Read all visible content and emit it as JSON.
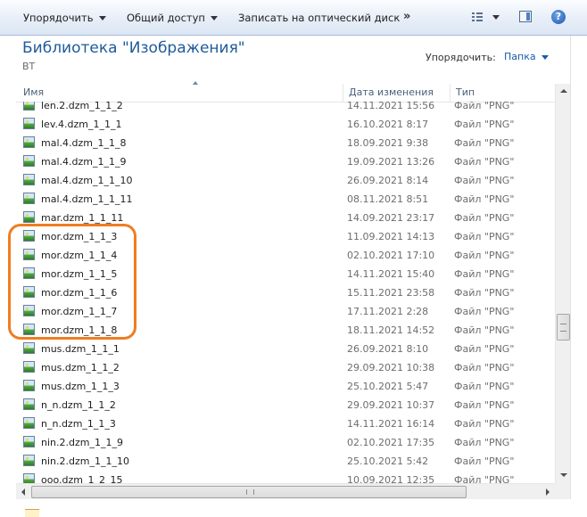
{
  "toolbar": {
    "organize": "Упорядочить",
    "share": "Общий доступ",
    "burn": "Записать на оптический диск",
    "more": "»",
    "help": "?"
  },
  "library": {
    "title": "Библиотека \"Изображения\"",
    "subtitle": "ВТ",
    "arrange_label": "Упорядочить:",
    "arrange_value": "Папка"
  },
  "columns": {
    "name": "Имя",
    "date": "Дата изменения",
    "type": "Тип"
  },
  "files": [
    {
      "name": "len.2.dzm_1_1_2",
      "date": "14.11.2021 15:56",
      "type": "Файл \"PNG\""
    },
    {
      "name": "lev.4.dzm_1_1_1",
      "date": "16.10.2021 8:17",
      "type": "Файл \"PNG\""
    },
    {
      "name": "mal.4.dzm_1_1_8",
      "date": "18.09.2021 9:38",
      "type": "Файл \"PNG\""
    },
    {
      "name": "mal.4.dzm_1_1_9",
      "date": "19.09.2021 13:26",
      "type": "Файл \"PNG\""
    },
    {
      "name": "mal.4.dzm_1_1_10",
      "date": "26.09.2021 8:14",
      "type": "Файл \"PNG\""
    },
    {
      "name": "mal.4.dzm_1_1_11",
      "date": "08.11.2021 8:51",
      "type": "Файл \"PNG\""
    },
    {
      "name": "mar.dzm_1_1_11",
      "date": "14.09.2021 23:17",
      "type": "Файл \"PNG\""
    },
    {
      "name": "mor.dzm_1_1_3",
      "date": "11.09.2021 14:13",
      "type": "Файл \"PNG\""
    },
    {
      "name": "mor.dzm_1_1_4",
      "date": "02.10.2021 17:10",
      "type": "Файл \"PNG\""
    },
    {
      "name": "mor.dzm_1_1_5",
      "date": "14.11.2021 15:40",
      "type": "Файл \"PNG\""
    },
    {
      "name": "mor.dzm_1_1_6",
      "date": "15.11.2021 23:58",
      "type": "Файл \"PNG\""
    },
    {
      "name": "mor.dzm_1_1_7",
      "date": "17.11.2021 2:28",
      "type": "Файл \"PNG\""
    },
    {
      "name": "mor.dzm_1_1_8",
      "date": "18.11.2021 14:52",
      "type": "Файл \"PNG\""
    },
    {
      "name": "mus.dzm_1_1_1",
      "date": "26.09.2021 8:10",
      "type": "Файл \"PNG\""
    },
    {
      "name": "mus.dzm_1_1_2",
      "date": "29.09.2021 10:38",
      "type": "Файл \"PNG\""
    },
    {
      "name": "mus.dzm_1_1_3",
      "date": "25.10.2021 5:47",
      "type": "Файл \"PNG\""
    },
    {
      "name": "n_n.dzm_1_1_2",
      "date": "29.09.2021 10:37",
      "type": "Файл \"PNG\""
    },
    {
      "name": "n_n.dzm_1_1_3",
      "date": "14.11.2021 16:14",
      "type": "Файл \"PNG\""
    },
    {
      "name": "nin.2.dzm_1_1_9",
      "date": "02.10.2021 17:35",
      "type": "Файл \"PNG\""
    },
    {
      "name": "nin.2.dzm_1_1_10",
      "date": "25.10.2021 5:42",
      "type": "Файл \"PNG\""
    },
    {
      "name": "ooo.dzm_1_2_15",
      "date": "10.09.2021 12:35",
      "type": "Файл \"PNG\""
    }
  ],
  "icons": {
    "file": "png-image-icon",
    "views": "view-list-icon",
    "preview": "preview-pane-icon",
    "help": "help-icon"
  },
  "colors": {
    "title": "#1e5b9b",
    "highlight": "#ef7d22",
    "link": "#1a5aa8"
  }
}
